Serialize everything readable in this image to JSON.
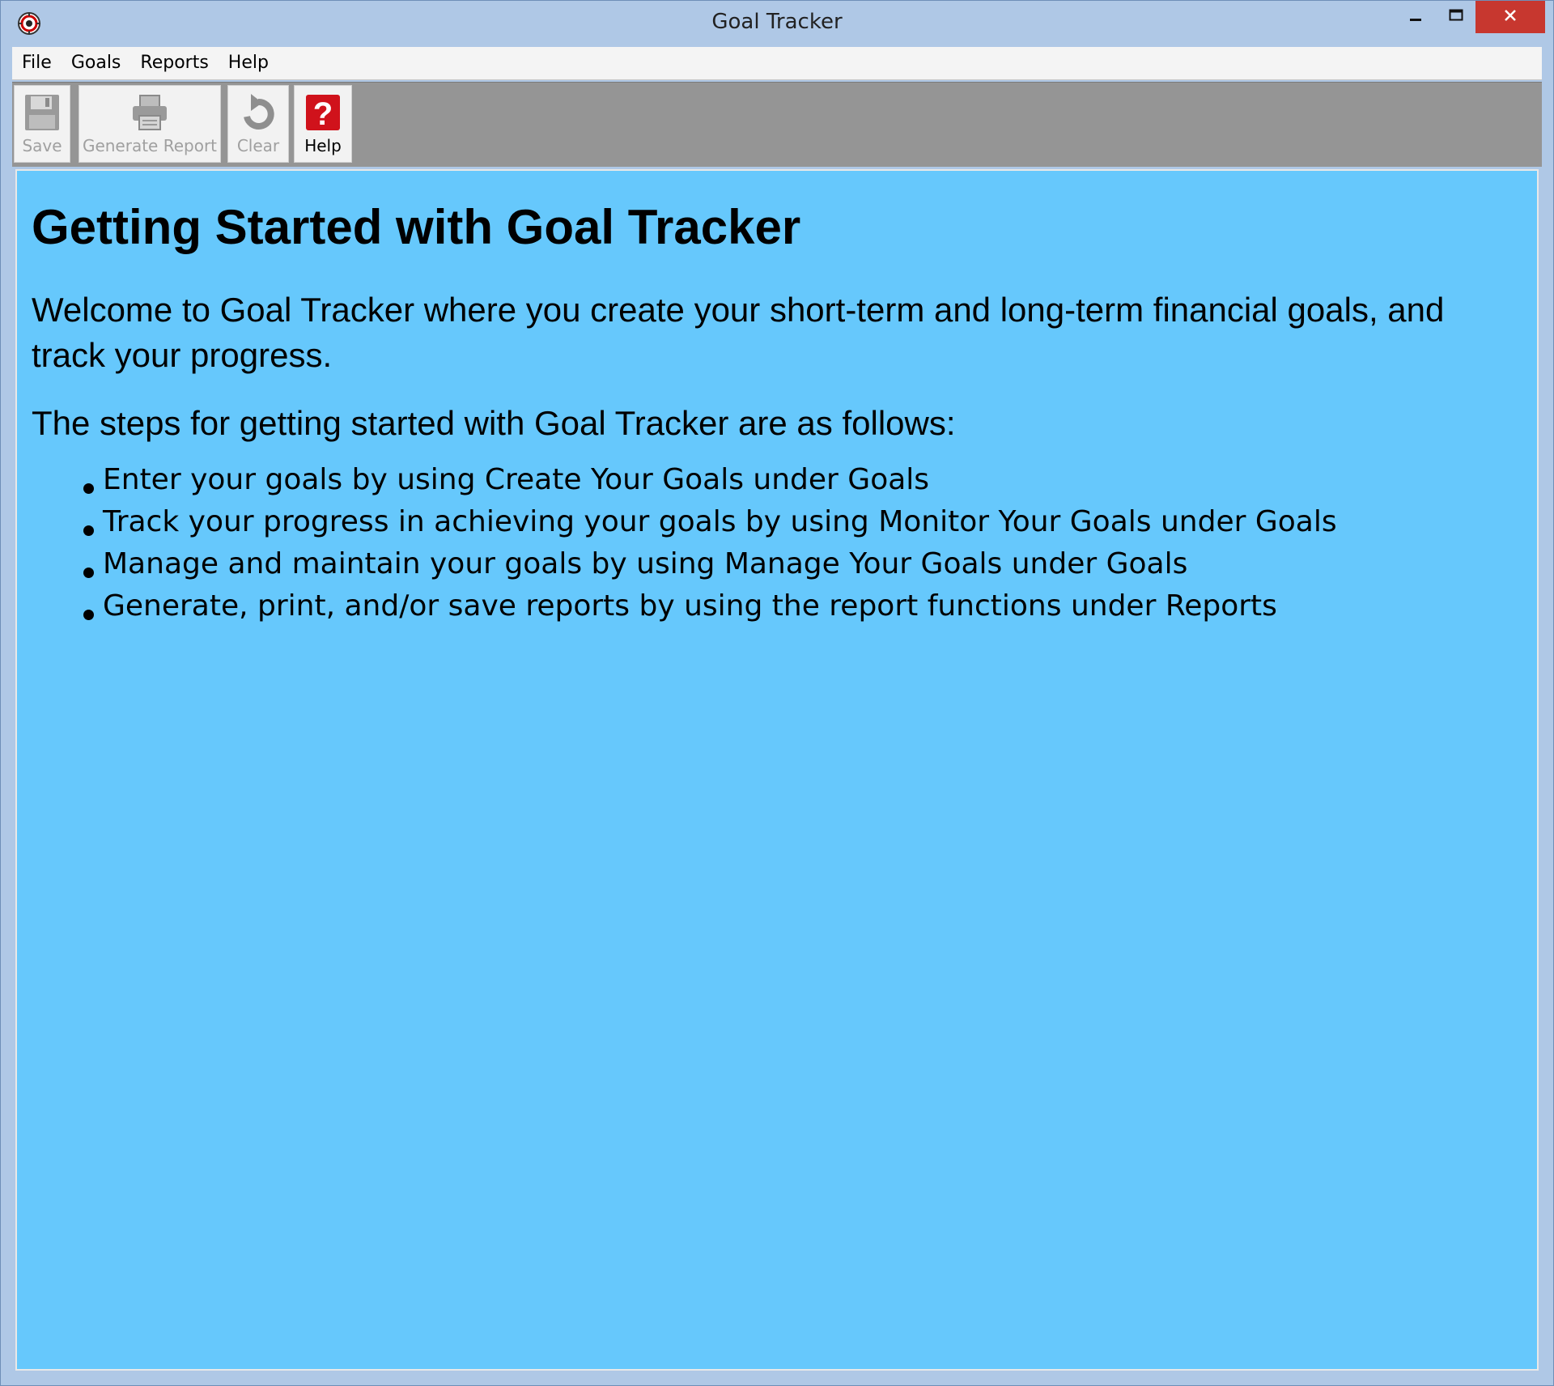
{
  "window": {
    "title": "Goal Tracker",
    "close_color": "#c7372f"
  },
  "menu": {
    "items": [
      "File",
      "Goals",
      "Reports",
      "Help"
    ]
  },
  "toolbar": {
    "save_label": "Save",
    "report_label": "Generate Report",
    "clear_label": "Clear",
    "help_label": "Help",
    "help_glyph": "?",
    "help_icon_color": "#d0121b"
  },
  "content": {
    "background": "#66c8fc",
    "heading": "Getting Started with Goal Tracker",
    "welcome": "Welcome to Goal Tracker where you create your short-term and long-term financial goals, and track your progress.",
    "steps_intro": "The steps for getting started with Goal Tracker are as follows:",
    "steps": [
      "Enter your goals by using Create Your Goals under Goals",
      "Track your progress in achieving your goals by using Monitor Your Goals under Goals",
      "Manage and maintain your goals by using Manage Your Goals under Goals",
      "Generate, print, and/or save reports by using the report functions under Reports"
    ]
  }
}
